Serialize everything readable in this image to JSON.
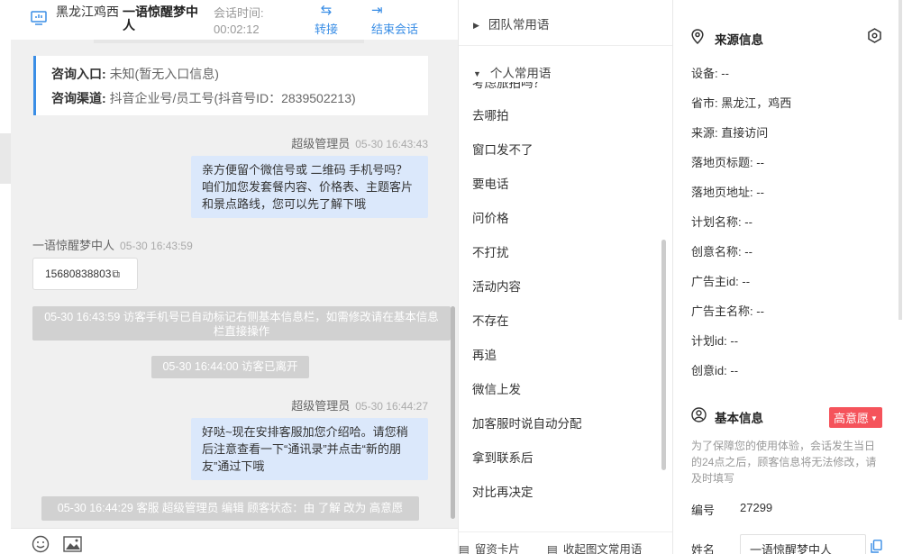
{
  "header": {
    "region": "黑龙江鸡西",
    "visitor_name": "一语惊醒梦中人",
    "session_time_label": "会话时间:",
    "session_time_value": "00:02:12",
    "transfer_label": "转接",
    "end_label": "结束会话"
  },
  "source_card": {
    "entry_label": "咨询入口:",
    "entry_value": "未知(暂无入口信息)",
    "channel_label": "咨询渠道:",
    "channel_value": "抖音企业号/员工号(抖音号ID：2839502213)"
  },
  "messages": {
    "m1_sender": "超级管理员",
    "m1_time": "05-30 16:43:43",
    "m1_text": "亲方便留个微信号或 二维码 手机号吗？咱们加您发套餐内容、价格表、主题客片和景点路线，您可以先了解下哦",
    "m2_sender": "一语惊醒梦中人",
    "m2_time": "05-30 16:43:59",
    "m2_phone": "15680838803",
    "sys1": "05-30 16:43:59 访客手机号已自动标记右侧基本信息栏，如需修改请在基本信息栏直接操作",
    "sys2": "05-30 16:44:00 访客已离开",
    "m3_sender": "超级管理员",
    "m3_time": "05-30 16:44:27",
    "m3_text": "好哒~现在安排客服加您介绍哈。请您稍后注意查看一下“通讯录”并点击“新的朋友”通过下哦",
    "sys3": "05-30 16:44:29 客服 超级管理员 编辑 顾客状态：由 了解 改为 高意愿"
  },
  "phrases": {
    "team_group": "团队常用语",
    "personal_group": "个人常用语",
    "partial_top": "考虑旅拍吗？",
    "items": [
      "去哪拍",
      "窗口发不了",
      "要电话",
      "问价格",
      "不打扰",
      "活动内容",
      "不存在",
      "再追",
      "微信上发",
      "加客服时说自动分配",
      "拿到联系后",
      "对比再决定"
    ],
    "footer_card": "留资卡片",
    "footer_collapse": "收起图文常用语"
  },
  "source_info": {
    "title": "来源信息",
    "fields": [
      {
        "label": "设备:",
        "value": "--"
      },
      {
        "label": "省市:",
        "value": "黑龙江，鸡西"
      },
      {
        "label": "来源:",
        "value": "直接访问"
      },
      {
        "label": "落地页标题:",
        "value": "--"
      },
      {
        "label": "落地页地址:",
        "value": "--"
      },
      {
        "label": "计划名称:",
        "value": "--"
      },
      {
        "label": "创意名称:",
        "value": "--"
      },
      {
        "label": "广告主id:",
        "value": "--"
      },
      {
        "label": "广告主名称:",
        "value": "--"
      },
      {
        "label": "计划id:",
        "value": "--"
      },
      {
        "label": "创意id:",
        "value": "--"
      }
    ]
  },
  "basic_info": {
    "title": "基本信息",
    "intent_badge": "高意愿",
    "note": "为了保障您的使用体验，会话发生当日的24点之后，顾客信息将无法修改，请及时填写",
    "id_label": "编号",
    "id_value": "27299",
    "name_label": "姓名",
    "name_value": "一语惊醒梦中人"
  },
  "colors": {
    "accent": "#3a8ee6",
    "bubble": "#dbe8fb",
    "system_msg": "#d1d1d1",
    "badge": "#f5535b"
  }
}
